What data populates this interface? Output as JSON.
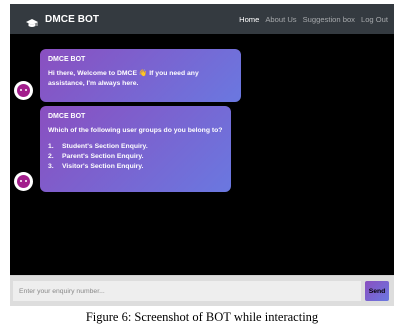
{
  "app": {
    "brand": "DMCE BOT",
    "brand_icon": "graduation-cap-icon"
  },
  "nav": {
    "items": [
      {
        "label": "Home",
        "active": true
      },
      {
        "label": "About Us",
        "active": false
      },
      {
        "label": "Suggestion box",
        "active": false
      },
      {
        "label": "Log Out",
        "active": false
      }
    ]
  },
  "messages": [
    {
      "sender": "DMCE BOT",
      "text": "Hi there, Welcome to DMCE 👋 If you need any assistance, I'm always here."
    },
    {
      "sender": "DMCE BOT",
      "text": "Which of the following user groups do you belong to?",
      "options": [
        {
          "num": "1.",
          "label": "Student's Section Enquiry."
        },
        {
          "num": "2.",
          "label": "Parent's Section Enquiry."
        },
        {
          "num": "3.",
          "label": "Visitor's Section Enquiry."
        }
      ]
    }
  ],
  "input": {
    "placeholder": "Enter your enquiry number...",
    "value": ""
  },
  "send_label": "Send",
  "caption": "Figure 6: Screenshot of BOT while interacting",
  "colors": {
    "navbar": "#343a40",
    "chat_background": "#000000",
    "bubble_gradient_start": "#8a4fc0",
    "bubble_gradient_end": "#6a78e0",
    "avatar": "#a21e8c"
  }
}
